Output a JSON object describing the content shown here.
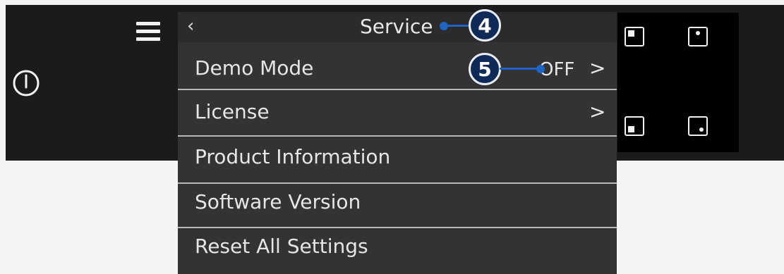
{
  "header": {
    "title": "Service",
    "back_icon": "chevron-left-icon"
  },
  "menu": {
    "items": [
      {
        "label": "Demo Mode",
        "value": "OFF",
        "chevron": ">"
      },
      {
        "label": "License",
        "chevron": ">"
      },
      {
        "label": "Product Information"
      },
      {
        "label": "Software Version"
      },
      {
        "label": "Reset All Settings"
      }
    ]
  },
  "callouts": {
    "title": "4",
    "demo_mode": "5"
  },
  "toolbar": {
    "menu_icon": "hamburger-icon",
    "power_icon": "power-icon"
  },
  "layout_icons": [
    "quadrant-top-left-icon",
    "quadrant-top-right-icon",
    "quadrant-bottom-left-icon",
    "quadrant-bottom-right-icon"
  ],
  "colors": {
    "background": "#f4f4f4",
    "topbar": "#1b1b1d",
    "menu": "#333335",
    "menu_header": "#2b2b2d",
    "callout_fill": "#102a57",
    "callout_line": "#1e64c0"
  }
}
